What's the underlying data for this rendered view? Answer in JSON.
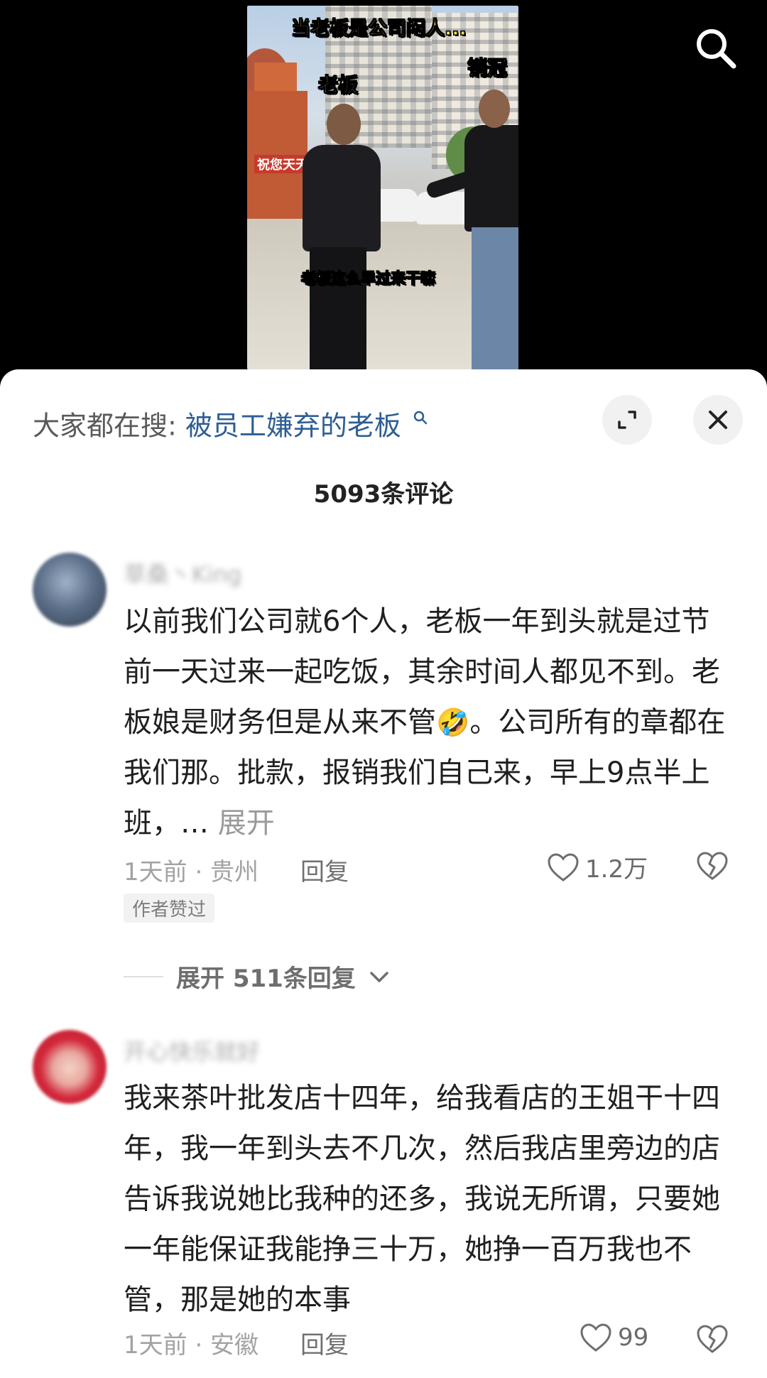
{
  "video": {
    "caption_title": "当老板是公司闲人...",
    "label_left": "老板",
    "label_right": "销冠",
    "subtitle": "老板这么早过来干嘛",
    "sign_text": "祝您天天"
  },
  "search": {
    "prefix": "大家都在搜:",
    "term": "被员工嫌弃的老板"
  },
  "comments_header": {
    "count_label": "5093条评论"
  },
  "comments": [
    {
      "username": "草桑丶King",
      "text_before_emoji": "以前我们公司就6个人，老板一年到头就是过节前一天过来一起吃饭，其余时间人都见不到。老板娘是财务但是从来不管",
      "emoji": "🤣",
      "text_after_emoji": "。公司所有的章都在我们那。批款，报销我们自己来，早上9点半上班，…",
      "more_label": "展开",
      "time_location": "1天前 · 贵州",
      "reply_label": "回复",
      "likes": "1.2万",
      "badge": "作者赞过",
      "expand_replies_label": "展开 511条回复"
    },
    {
      "username": "开心快乐就好",
      "text": "我来茶叶批发店十四年，给我看店的王姐干十四年，我一年到头去不几次，然后我店里旁边的店告诉我说她比我种的还多，我说无所谓，只要她一年能保证我能挣三十万，她挣一百万我也不管，那是她的本事",
      "time_location": "1天前 · 安徽",
      "reply_label": "回复",
      "likes": "99"
    }
  ],
  "icons": {
    "search": "search-icon",
    "expand": "expand-icon",
    "close": "close-icon",
    "like": "heart-outline-icon",
    "dislike": "broken-heart-icon",
    "chevron": "chevron-down-icon"
  },
  "colors": {
    "search_term": "#2e5e94",
    "caption_yellow": "#ffe24a"
  }
}
